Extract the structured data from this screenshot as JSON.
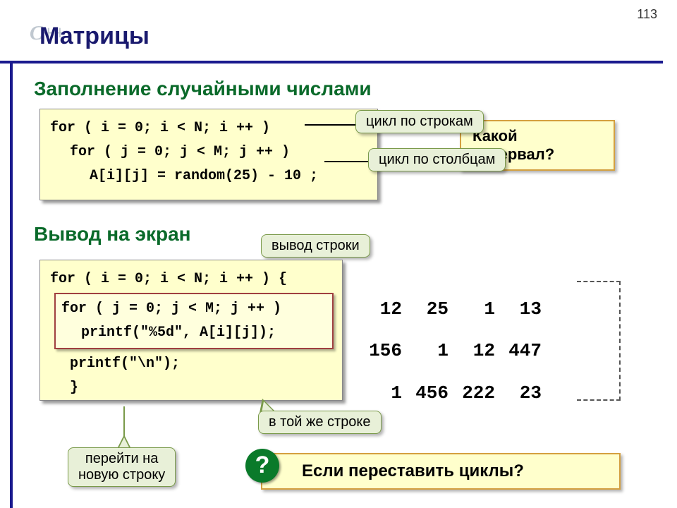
{
  "page_number": "113",
  "cpp_label": "C++",
  "title": "Матрицы",
  "section1": "Заполнение случайными числами",
  "section2": "Вывод на экран",
  "code1": {
    "l1": "for ( i = 0; i < N; i ++ )",
    "l2": "for ( j = 0; j < M; j ++ )",
    "l3": "A[i][j] = random(25) - 10 ;"
  },
  "code2": {
    "l1": "for ( i = 0; i < N; i ++ ) {",
    "inner_l1": "for ( j = 0; j < M; j ++ )",
    "inner_l2": "printf(\"%5d\", A[i][j]);",
    "l3": "printf(\"\\n\");",
    "l4": "}"
  },
  "callouts": {
    "rows": "цикл по строкам",
    "cols": "цикл по столбцам",
    "out_row": "вывод строки",
    "same_line": "в той же строке",
    "newline": "перейти на\nновую строку"
  },
  "questions": {
    "q1": "Какой интервал?",
    "q2": "Если переставить циклы?"
  },
  "qmark": "?",
  "output": {
    "rows": [
      [
        "12",
        "25",
        "1",
        "13"
      ],
      [
        "156",
        "1",
        "12",
        "447"
      ],
      [
        "1",
        "456",
        "222",
        "23"
      ]
    ]
  }
}
